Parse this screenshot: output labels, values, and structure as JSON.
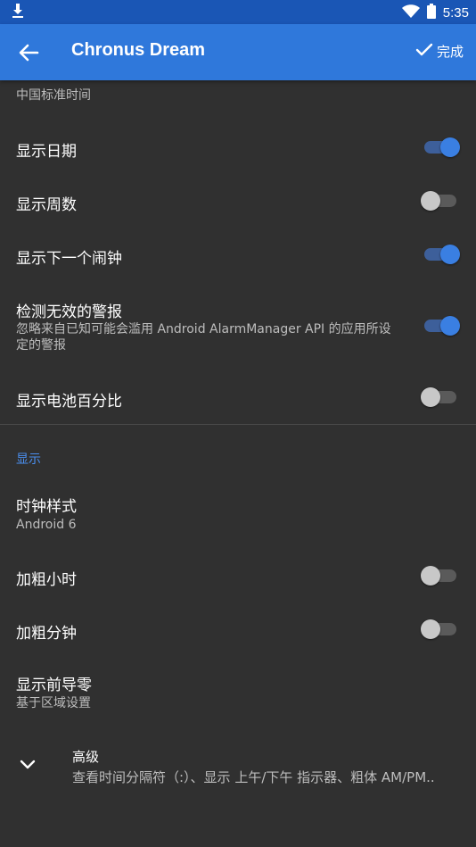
{
  "status_bar": {
    "time": "5:35"
  },
  "app_bar": {
    "title": "Chronus Dream",
    "done_label": "完成"
  },
  "timezone": {
    "subtitle": "中国标准时间"
  },
  "items": [
    {
      "title": "显示日期",
      "checked": true
    },
    {
      "title": "显示周数",
      "checked": false
    },
    {
      "title": "显示下一个闹钟",
      "checked": true
    },
    {
      "title": "检测无效的警报",
      "subtitle": "忽略来自已知可能会滥用 Android AlarmManager API 的应用所设定的警报",
      "checked": true
    },
    {
      "title": "显示电池百分比",
      "checked": false
    }
  ],
  "display_section": {
    "header": "显示",
    "clock_style": {
      "title": "时钟样式",
      "value": "Android 6"
    },
    "bold_hours": {
      "title": "加粗小时",
      "checked": false
    },
    "bold_minutes": {
      "title": "加粗分钟",
      "checked": false
    },
    "leading_zero": {
      "title": "显示前导零",
      "value": "基于区域设置"
    }
  },
  "advanced": {
    "title": "高级",
    "subtitle": "查看时间分隔符（:）、显示 上午/下午 指示器、粗体 AM/PM.."
  },
  "colors": {
    "accent": "#2f78db",
    "background": "#303030",
    "section": "#4a8ff0"
  }
}
